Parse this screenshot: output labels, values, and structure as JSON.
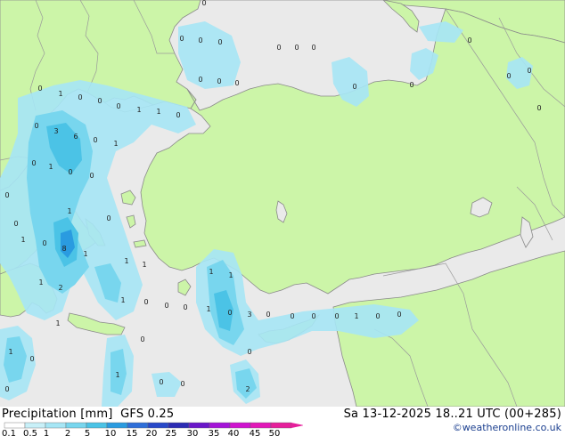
{
  "title": "Precipitation [mm]  GFS 0.25",
  "timestamp": "Sa 13-12-2025 18..21 UTC (00+285)",
  "credit": "©weatheronline.co.uk",
  "legend": {
    "ticks": [
      "0.1",
      "0.5",
      "1",
      "2",
      "5",
      "10",
      "15",
      "20",
      "25",
      "30",
      "35",
      "40",
      "45",
      "50"
    ],
    "colors": [
      "#ffffff",
      "#c8f0f8",
      "#a6e6f5",
      "#78d6ee",
      "#4bc3e6",
      "#2a9be0",
      "#2f6fd9",
      "#2849c9",
      "#2c2cb4",
      "#6a17c9",
      "#a414d8",
      "#cf13cf",
      "#e218b8",
      "#e61f9b"
    ]
  },
  "colors": {
    "land": "#ccf5a8",
    "sea": "#eaeaea",
    "border": "#9a9a9a",
    "coast": "#888888"
  },
  "values": [
    {
      "t": "0"
    },
    {
      "t": "0"
    },
    {
      "t": "0"
    },
    {
      "t": "0"
    },
    {
      "t": "0"
    },
    {
      "t": "0"
    },
    {
      "t": "0"
    },
    {
      "t": "0"
    },
    {
      "t": "0"
    },
    {
      "t": "0"
    },
    {
      "t": "0"
    },
    {
      "t": "0"
    },
    {
      "t": "0"
    },
    {
      "t": "0"
    },
    {
      "t": "0"
    },
    {
      "t": "0"
    },
    {
      "t": "1"
    },
    {
      "t": "0"
    },
    {
      "t": "0"
    },
    {
      "t": "0"
    },
    {
      "t": "0"
    },
    {
      "t": "1"
    },
    {
      "t": "1"
    },
    {
      "t": "0"
    },
    {
      "t": "0"
    },
    {
      "t": "3"
    },
    {
      "t": "6"
    },
    {
      "t": "0"
    },
    {
      "t": "1"
    },
    {
      "t": "0"
    },
    {
      "t": "1"
    },
    {
      "t": "0"
    },
    {
      "t": "0"
    },
    {
      "t": "0"
    },
    {
      "t": "0"
    },
    {
      "t": "1"
    },
    {
      "t": "0"
    },
    {
      "t": "1"
    },
    {
      "t": "0"
    },
    {
      "t": "8"
    },
    {
      "t": "1"
    },
    {
      "t": "1"
    },
    {
      "t": "1"
    },
    {
      "t": "2"
    },
    {
      "t": "1"
    },
    {
      "t": "0"
    },
    {
      "t": "0"
    },
    {
      "t": "0"
    },
    {
      "t": "1"
    },
    {
      "t": "0"
    },
    {
      "t": "1"
    },
    {
      "t": "1"
    },
    {
      "t": "1"
    },
    {
      "t": "3"
    },
    {
      "t": "0"
    },
    {
      "t": "0"
    },
    {
      "t": "0"
    },
    {
      "t": "0"
    },
    {
      "t": "1"
    },
    {
      "t": "0"
    },
    {
      "t": "0"
    },
    {
      "t": "1"
    },
    {
      "t": "1"
    },
    {
      "t": "0"
    },
    {
      "t": "1"
    },
    {
      "t": "0"
    },
    {
      "t": "0"
    },
    {
      "t": "0"
    },
    {
      "t": "2"
    },
    {
      "t": "0"
    },
    {
      "t": "0"
    }
  ]
}
